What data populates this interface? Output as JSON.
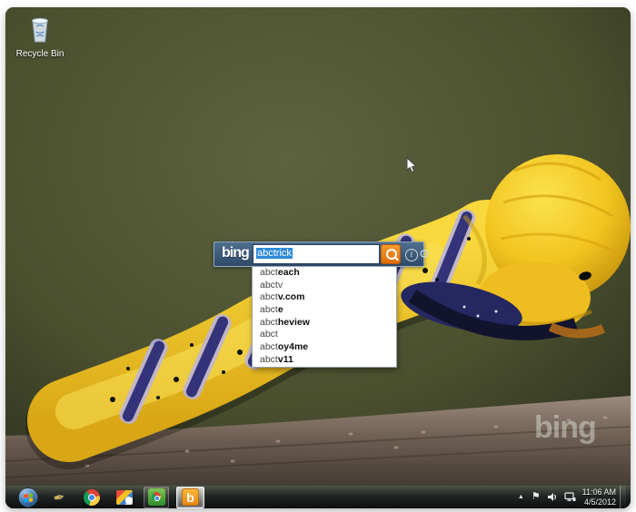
{
  "desktop": {
    "recycle_bin": {
      "label": "Recycle Bin"
    },
    "wallpaper_watermark": "bing"
  },
  "search_widget": {
    "logo": "bing",
    "query": "abctrick",
    "glyphs": {
      "info": "i",
      "gear": "⚙"
    },
    "suggestions": [
      {
        "match": "abct",
        "completion": "each"
      },
      {
        "match": "abct",
        "completion": "v"
      },
      {
        "match": "abct",
        "completion": "v.com"
      },
      {
        "match": "abct",
        "completion": "e"
      },
      {
        "match": "abct",
        "completion": "heview"
      },
      {
        "match": "abct",
        "completion": ""
      },
      {
        "match": "abct",
        "completion": "oy4me"
      },
      {
        "match": "abct",
        "completion": "v11"
      }
    ]
  },
  "taskbar": {
    "app_icons": [
      "start",
      "pen-app",
      "chrome",
      "photo-app",
      "green-chrome-app",
      "bing-desktop"
    ],
    "bing_app_glyph": "b",
    "tray": {
      "hidden_icons_glyph": "▲",
      "flag_glyph": "⚑",
      "time": "11:06 AM",
      "date": "4/5/2012"
    }
  },
  "colors": {
    "search_bar_blue": "#3b5a78",
    "search_button_orange": "#e8821e",
    "selection_blue": "#2e8ad8",
    "wallpaper_olive": "#4b5030",
    "caterpillar_yellow": "#f0c41f",
    "stripe_navy": "#34337a",
    "taskbar_dark": "#15181c"
  }
}
